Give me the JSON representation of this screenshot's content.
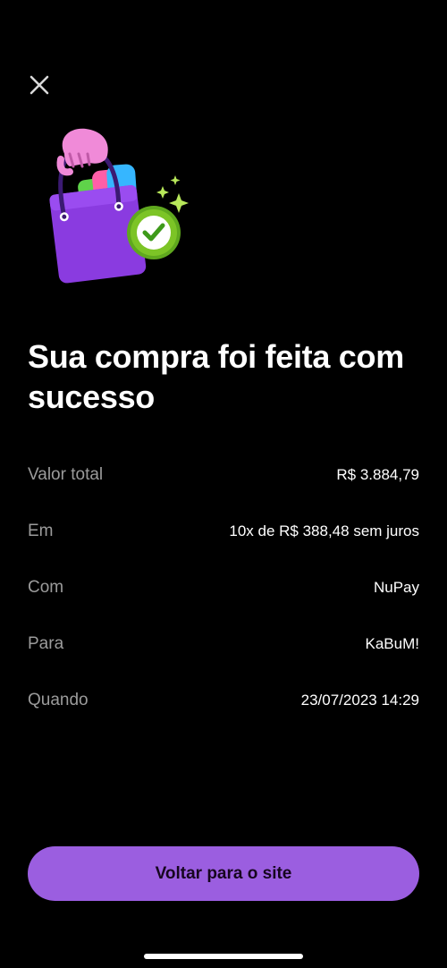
{
  "header": {
    "close_icon": "close-icon"
  },
  "illustration": {
    "icon": "shopping-bag-success-icon",
    "check_icon": "checkmark-icon"
  },
  "headline": "Sua compra foi feita com sucesso",
  "details": [
    {
      "label": "Valor total",
      "value": "R$ 3.884,79"
    },
    {
      "label": "Em",
      "value": "10x de R$ 388,48 sem juros"
    },
    {
      "label": "Com",
      "value": "NuPay"
    },
    {
      "label": "Para",
      "value": "KaBuM!"
    },
    {
      "label": "Quando",
      "value": "23/07/2023 14:29"
    }
  ],
  "primary_button": {
    "label": "Voltar para o site"
  },
  "colors": {
    "background": "#000000",
    "accent": "#9b5ee0",
    "label_gray": "#9b9b9b",
    "success_green": "#7cc426",
    "bag_purple": "#8a3be0"
  }
}
